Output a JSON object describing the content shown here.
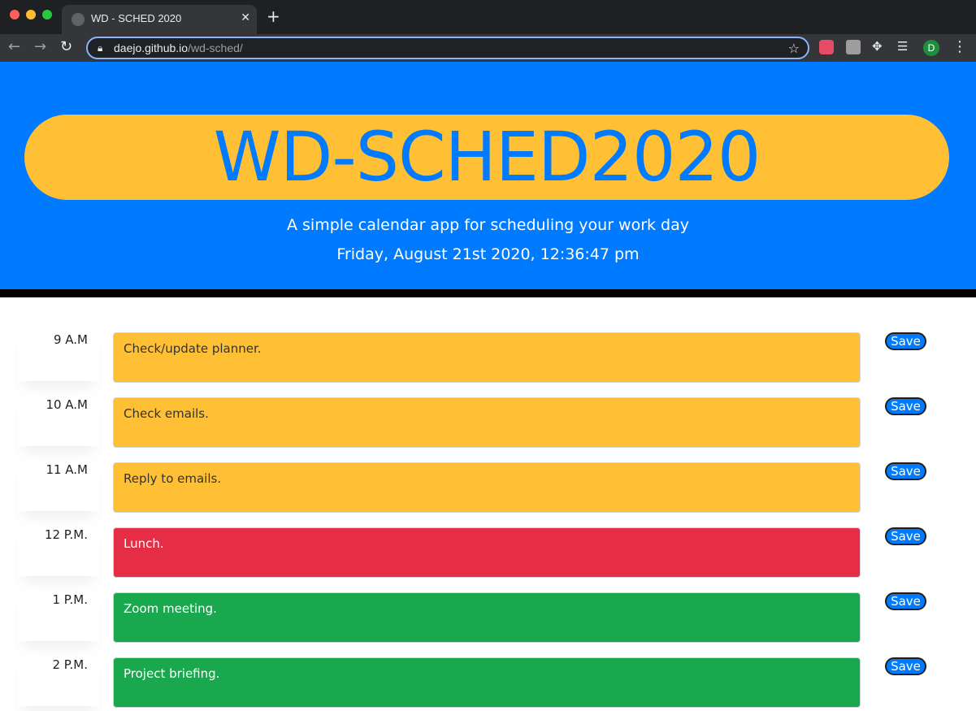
{
  "browser": {
    "tab_title": "WD - SCHED 2020",
    "url_host": "daejo.github.io",
    "url_path": "/wd-sched/",
    "profile_initial": "D",
    "icons": {
      "back": "back-arrow-icon",
      "forward": "forward-arrow-icon",
      "reload": "reload-icon",
      "lock": "lock-icon",
      "star": "bookmark-star-icon",
      "extensions": "puzzle-icon",
      "media": "media-queue-icon",
      "menu": "kebab-menu-icon"
    }
  },
  "header": {
    "title": "WD-SCHED2020",
    "lead": "A simple calendar app for scheduling your work day",
    "current_day": "Friday, August 21st 2020, 12:36:47 pm"
  },
  "schedule": [
    {
      "hour": "9 A.M",
      "text": "Check/update planner.",
      "state": "past",
      "save_label": "Save"
    },
    {
      "hour": "10 A.M",
      "text": "Check emails.",
      "state": "past",
      "save_label": "Save"
    },
    {
      "hour": "11 A.M",
      "text": "Reply to emails.",
      "state": "past",
      "save_label": "Save"
    },
    {
      "hour": "12 P.M.",
      "text": "Lunch.",
      "state": "present",
      "save_label": "Save"
    },
    {
      "hour": "1 P.M.",
      "text": "Zoom meeting.",
      "state": "future",
      "save_label": "Save"
    },
    {
      "hour": "2 P.M.",
      "text": "Project briefing.",
      "state": "future",
      "save_label": "Save"
    }
  ],
  "colors": {
    "header_bg": "#007bff",
    "title_pill": "#ffc035",
    "past": "#ffc035",
    "present": "#e52e45",
    "future": "#19a84e",
    "save_button": "#007bff"
  }
}
